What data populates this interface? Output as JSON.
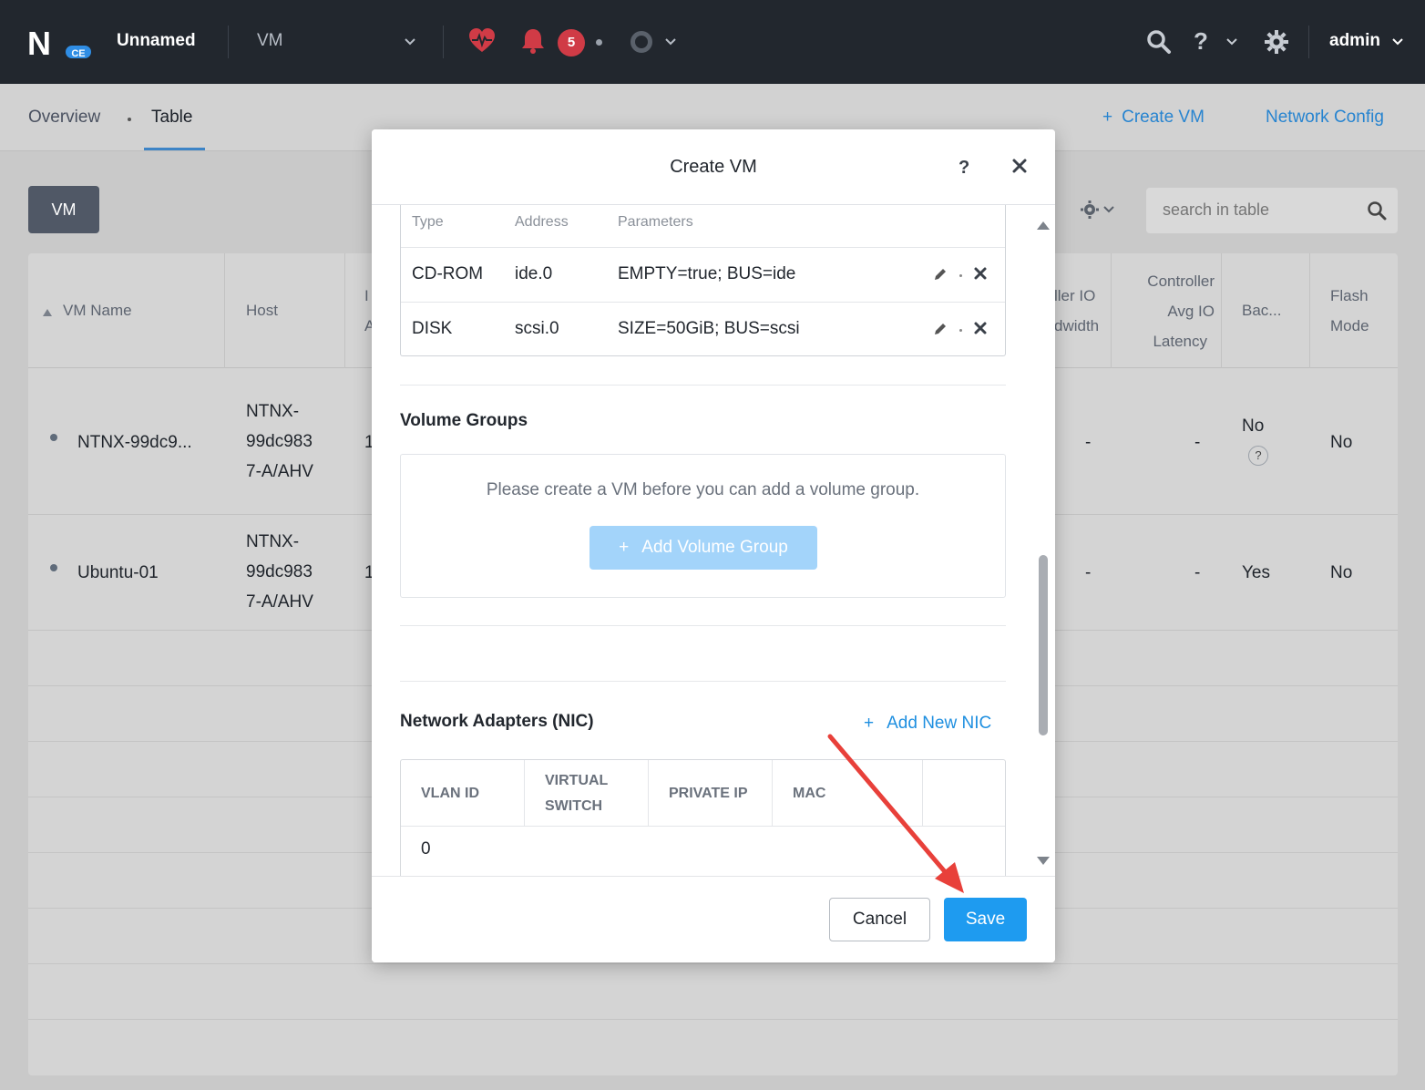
{
  "topbar": {
    "logo_letter": "N",
    "logo_badge": "CE",
    "cluster_name": "Unnamed",
    "entity": "VM",
    "alert_count": "5",
    "user": "admin"
  },
  "subnav": {
    "tabs": [
      {
        "label": "Overview"
      },
      {
        "label": "Table"
      }
    ],
    "create_vm": "Create VM",
    "network_config": "Network Config"
  },
  "toolbar": {
    "vm_label": "VM",
    "search_placeholder": "search in table"
  },
  "bg_table": {
    "headers": {
      "vm_name": "VM Name",
      "host": "Host",
      "ip_partial_1": "I",
      "ip_partial_2": "A",
      "ctrl_bw_1": "ller IO",
      "ctrl_bw_2": "dwidth",
      "ctrl_lat_1": "Controller",
      "ctrl_lat_2": "Avg IO",
      "ctrl_lat_3": "Latency",
      "backup": "Bac...",
      "flash_1": "Flash",
      "flash_2": "Mode"
    },
    "rows": [
      {
        "name": "NTNX-99dc9...",
        "host_1": "NTNX-",
        "host_2": "99dc983",
        "host_3": "7-A/AHV",
        "ip_partial": "1",
        "ctrl_bw": "-",
        "ctrl_lat": "-",
        "backup": "No",
        "backup_help": "?",
        "flash": "No"
      },
      {
        "name": "Ubuntu-01",
        "host_1": "NTNX-",
        "host_2": "99dc983",
        "host_3": "7-A/AHV",
        "ip_partial": "1",
        "ctrl_bw": "-",
        "ctrl_lat": "-",
        "backup": "Yes",
        "flash": "No"
      }
    ]
  },
  "modal": {
    "title": "Create VM",
    "help": "?",
    "disks": {
      "headers": {
        "type": "Type",
        "address": "Address",
        "parameters": "Parameters"
      },
      "rows": [
        {
          "type": "CD-ROM",
          "address": "ide.0",
          "parameters": "EMPTY=true; BUS=ide"
        },
        {
          "type": "DISK",
          "address": "scsi.0",
          "parameters": "SIZE=50GiB; BUS=scsi"
        }
      ]
    },
    "volume_groups": {
      "title": "Volume Groups",
      "message": "Please create a VM before you can add a volume group.",
      "add_button": "Add Volume Group"
    },
    "nics": {
      "title": "Network Adapters (NIC)",
      "add_button": "Add New NIC",
      "headers": {
        "vlan": "VLAN ID",
        "vswitch_1": "VIRTUAL",
        "vswitch_2": "SWITCH",
        "private_ip": "PRIVATE IP",
        "mac": "MAC"
      },
      "rows": [
        {
          "vlan": "0"
        }
      ]
    },
    "cancel": "Cancel",
    "save": "Save"
  },
  "colors": {
    "topbar_bg": "#22272e",
    "accent_blue": "#1e9bf0",
    "link_blue": "#2784d0",
    "alert_red": "#d03b46",
    "annotation_arrow": "#e8403a"
  }
}
